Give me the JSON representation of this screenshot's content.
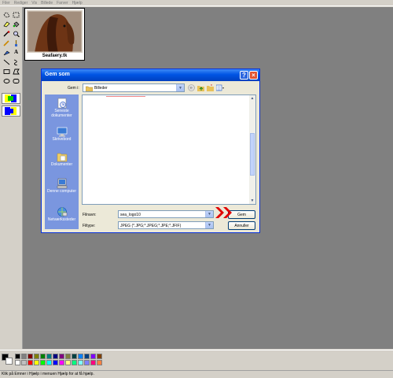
{
  "menu": [
    "Filer",
    "Rediger",
    "Vis",
    "Billede",
    "Farver",
    "Hjælp"
  ],
  "tools": [
    "free-select",
    "rect-select",
    "eraser",
    "fill",
    "color-picker",
    "magnifier",
    "pencil",
    "brush",
    "airbrush",
    "text",
    "line",
    "curve",
    "rectangle",
    "polygon",
    "ellipse",
    "rounded-rectangle"
  ],
  "image": {
    "caption": "Seafaery.tk"
  },
  "dialog": {
    "title": "Gem som",
    "help_label": "?",
    "close_label": "×",
    "lookin_label": "Gem i:",
    "lookin_value": "Billeder",
    "places": [
      "Seneste dokumenter",
      "Skrivebord",
      "Dokumenter",
      "Denne computer",
      "Netværkssteder"
    ],
    "filename_label": "Filnavn:",
    "filename_value": "sea_logo10",
    "filetype_label": "Filtype:",
    "filetype_value": "JPEG (*.JPG;*.JPEG;*.JPE;*.JFIF)",
    "save_button": "Gem",
    "cancel_button": "Annuller"
  },
  "palette": [
    "#000000",
    "#808080",
    "#800000",
    "#808000",
    "#008000",
    "#008080",
    "#000080",
    "#800080",
    "#808040",
    "#004040",
    "#0080ff",
    "#004080",
    "#8000ff",
    "#804000",
    "#ffffff",
    "#c0c0c0",
    "#ff0000",
    "#ffff00",
    "#00ff00",
    "#00ffff",
    "#0000ff",
    "#ff00ff",
    "#ffff80",
    "#00ff80",
    "#80ffff",
    "#8080ff",
    "#ff0080",
    "#ff8040"
  ],
  "status": "Klik på Emner i Hjælp i menuen Hjælp for at få hjælp."
}
